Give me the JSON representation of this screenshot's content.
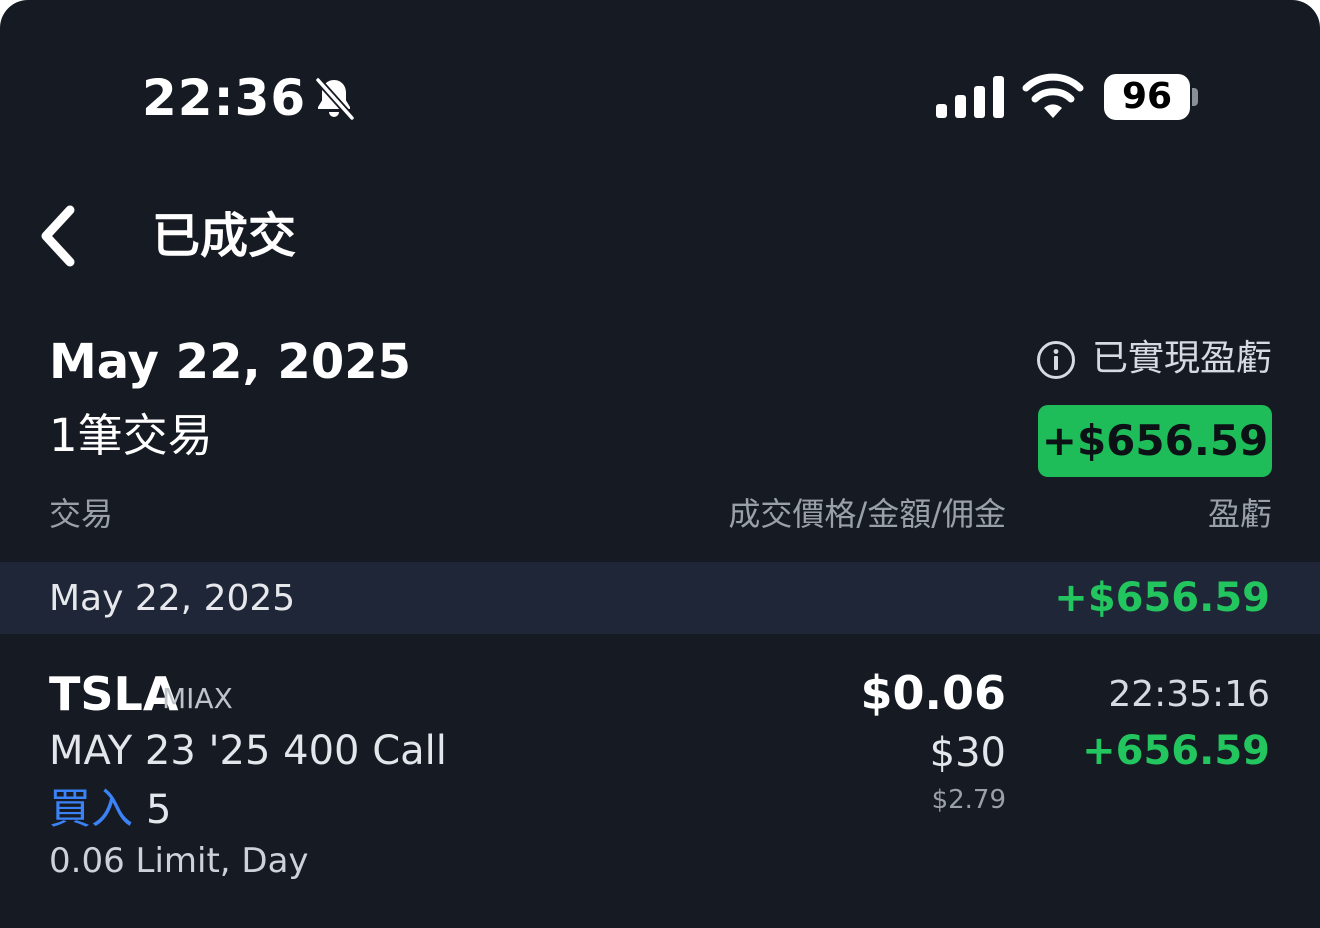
{
  "status_bar": {
    "time": "22:36",
    "battery": "96",
    "icons": [
      "bell-slash-icon",
      "cellular-signal-icon",
      "wifi-icon",
      "battery-icon"
    ]
  },
  "nav": {
    "back_icon": "chevron-left-icon",
    "title": "已成交"
  },
  "summary": {
    "date": "May 22, 2025",
    "trade_count": "1筆交易",
    "realized_label": "已實現盈虧",
    "realized_value": "+$656.59"
  },
  "columns": {
    "trade": "交易",
    "price_amount_commission": "成交價格/金額/佣金",
    "pnl": "盈虧"
  },
  "groups": [
    {
      "date": "May 22, 2025",
      "pnl": "+$656.59",
      "trades": [
        {
          "symbol": "TSLA",
          "exchange": "MIAX",
          "contract": "MAY 23 '25 400 Call",
          "side": "買入",
          "quantity": "5",
          "order_type": "0.06 Limit, Day",
          "price": "$0.06",
          "amount": "$30",
          "commission": "$2.79",
          "time": "22:35:16",
          "pnl": "+656.59"
        }
      ]
    }
  ],
  "colors": {
    "background": "#151a23",
    "group_row": "#1e2638",
    "positive": "#22c55e",
    "badge": "#1ebd5a",
    "buy": "#3b82f6"
  }
}
